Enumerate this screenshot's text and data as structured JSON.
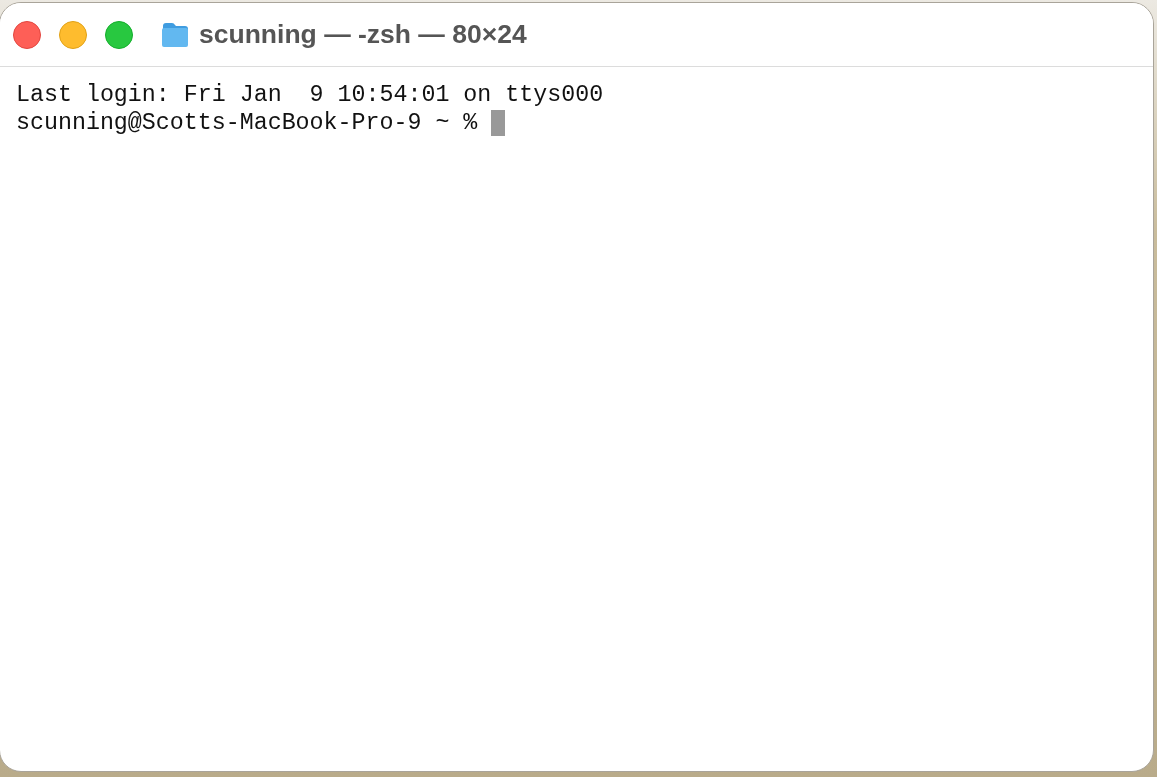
{
  "window": {
    "title": "scunning — -zsh — 80×24",
    "controls": [
      {
        "kind": "close"
      },
      {
        "kind": "minimize"
      },
      {
        "kind": "zoom"
      }
    ]
  },
  "terminal": {
    "lines": [
      {
        "text": "Last login: Fri Jan  9 10:54:01 on ttys000",
        "cursor": false
      },
      {
        "text": "scunning@Scotts-MacBook-Pro-9 ~ %",
        "cursor": true
      }
    ]
  }
}
